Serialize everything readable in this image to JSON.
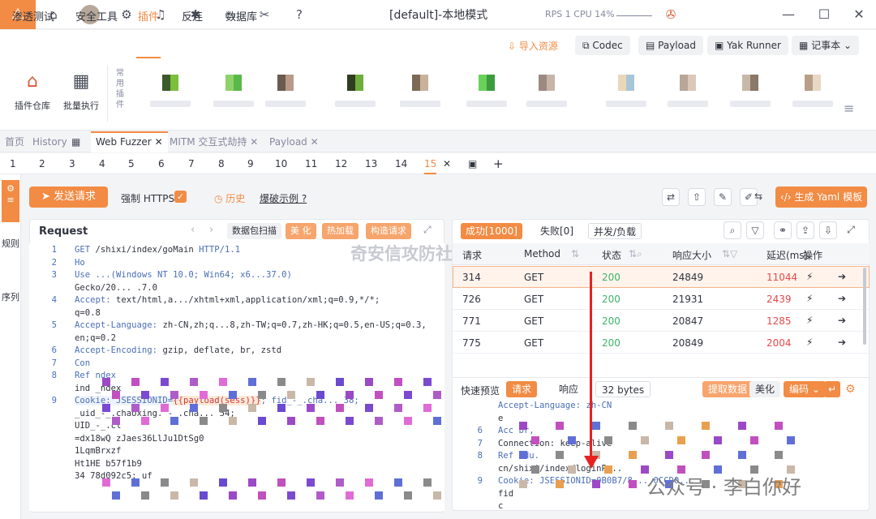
{
  "window": {
    "title_mode": "[default]-本地模式",
    "rps": "RPS 1",
    "cpu": "CPU 14%"
  },
  "menu": {
    "items": [
      "渗透测试",
      "安全工具",
      "插件",
      "反连",
      "数据库"
    ],
    "active": "插件",
    "import_label": "导入资源",
    "codec": "Codec",
    "payload": "Payload",
    "yak_runner": "Yak Runner",
    "notebook": "记事本"
  },
  "plugins": {
    "store": "插件仓库",
    "batch": "批量执行",
    "common_label": "常用插件"
  },
  "tabs": {
    "items": [
      "首页",
      "History",
      "Web Fuzzer",
      "MITM 交互式劫持",
      "Payload"
    ],
    "active": "Web Fuzzer"
  },
  "numtabs": {
    "items": [
      "1",
      "2",
      "3",
      "4",
      "5",
      "6",
      "7",
      "8",
      "9",
      "10",
      "11",
      "12",
      "13",
      "14",
      "15"
    ],
    "active": "15"
  },
  "sidebar": {
    "items": [
      "规则",
      "序列"
    ]
  },
  "toolbar": {
    "send": "发送请求",
    "force_https": "强制 HTTPS",
    "history": "历史",
    "example": "爆破示例",
    "gen_yaml": "生成 Yaml 模板"
  },
  "request": {
    "title": "Request",
    "btn_scan": "数据包扫描",
    "btn_beautify": "美 化",
    "btn_hotload": "热加载",
    "btn_construct": "构造请求"
  },
  "code": [
    {
      "n": "1",
      "text": "GET /shixi/index/goMain HTTP/1.1"
    },
    {
      "n": "2",
      "text": "Ho"
    },
    {
      "n": "3",
      "text": "Use ...(Windows NT 10.0; Win64; x6...37.0)"
    },
    {
      "n": "",
      "text": "Gecko/20...   .7.0"
    },
    {
      "n": "4",
      "text": "Accept: text/html,a.../xhtml+xml,application/xml;q=0.9,*/*;"
    },
    {
      "n": "",
      "text": "q=0.8"
    },
    {
      "n": "5",
      "text": "Accept-Language: zh-CN,zh;q...8,zh-TW;q=0.7,zh-HK;q=0.5,en-US;q=0.3,"
    },
    {
      "n": "",
      "text": "en;q=0.2"
    },
    {
      "n": "6",
      "text": "Accept-Encoding: gzip, deflate, br, zstd"
    },
    {
      "n": "7",
      "text": "Con"
    },
    {
      "n": "8",
      "text": "Ref                                  ndex"
    },
    {
      "n": "",
      "text": "ind        _ndex"
    },
    {
      "n": "9",
      "text": "Cookie: JSESSIONID={{payload(sess)}}; fid_-_.cha...     38;"
    },
    {
      "n": "",
      "text": "_uid_-_.chaoxing.          -_.cha...           54;"
    },
    {
      "n": "",
      "text": "UID_-_.cl"
    },
    {
      "n": "",
      "text": "  =dx18wQ                          zJaes36LlJu1DtSg0"
    },
    {
      "n": "",
      "text": "                                      1LqmBrxzf"
    },
    {
      "n": "",
      "text": "Ht1HE                                     b57f1b9"
    },
    {
      "n": "",
      "text": "34      78d092c5: uf"
    }
  ],
  "results": {
    "success": "成功[1000]",
    "fail": "失败[0]",
    "concurrency": "并发/负载",
    "headers": [
      "请求",
      "Method",
      "状态",
      "响应大小",
      "延迟(ms)",
      "操作"
    ],
    "rows": [
      {
        "id": "314",
        "method": "GET",
        "status": "200",
        "size": "24849",
        "delay": "11044"
      },
      {
        "id": "726",
        "method": "GET",
        "status": "200",
        "size": "21931",
        "delay": "2439"
      },
      {
        "id": "771",
        "method": "GET",
        "status": "200",
        "size": "20847",
        "delay": "1285"
      },
      {
        "id": "775",
        "method": "GET",
        "status": "200",
        "size": "20849",
        "delay": "2004"
      }
    ]
  },
  "preview": {
    "label": "快速预览",
    "req": "请求",
    "resp": "响应",
    "bytes": "32 bytes",
    "extract": "提取数据",
    "beautify": "美化",
    "encode": "编码",
    "lines": [
      {
        "n": "",
        "text": "Accept-Language: zh-CN"
      },
      {
        "n": "",
        "text": "e"
      },
      {
        "n": "6",
        "text": "Acc                     br,"
      },
      {
        "n": "7",
        "text": "Connection: keep-alive"
      },
      {
        "n": "8",
        "text": "Ref                        edu."
      },
      {
        "n": "",
        "text": "cn/shixi/index/loginP..."
      },
      {
        "n": "9",
        "text": "Cookie: JSESSIONID=0B0B7/8...   0CCD0..."
      },
      {
        "n": "",
        "text": "fid"
      },
      {
        "n": "",
        "text": "c"
      }
    ]
  },
  "watermark": {
    "a": "奇安信攻防社区",
    "b": "公众号 · 李白你好"
  },
  "colors": {
    "accent": "#f28b44",
    "success": "#3eb36b",
    "danger": "#e54848",
    "link": "#4a6fb5"
  }
}
